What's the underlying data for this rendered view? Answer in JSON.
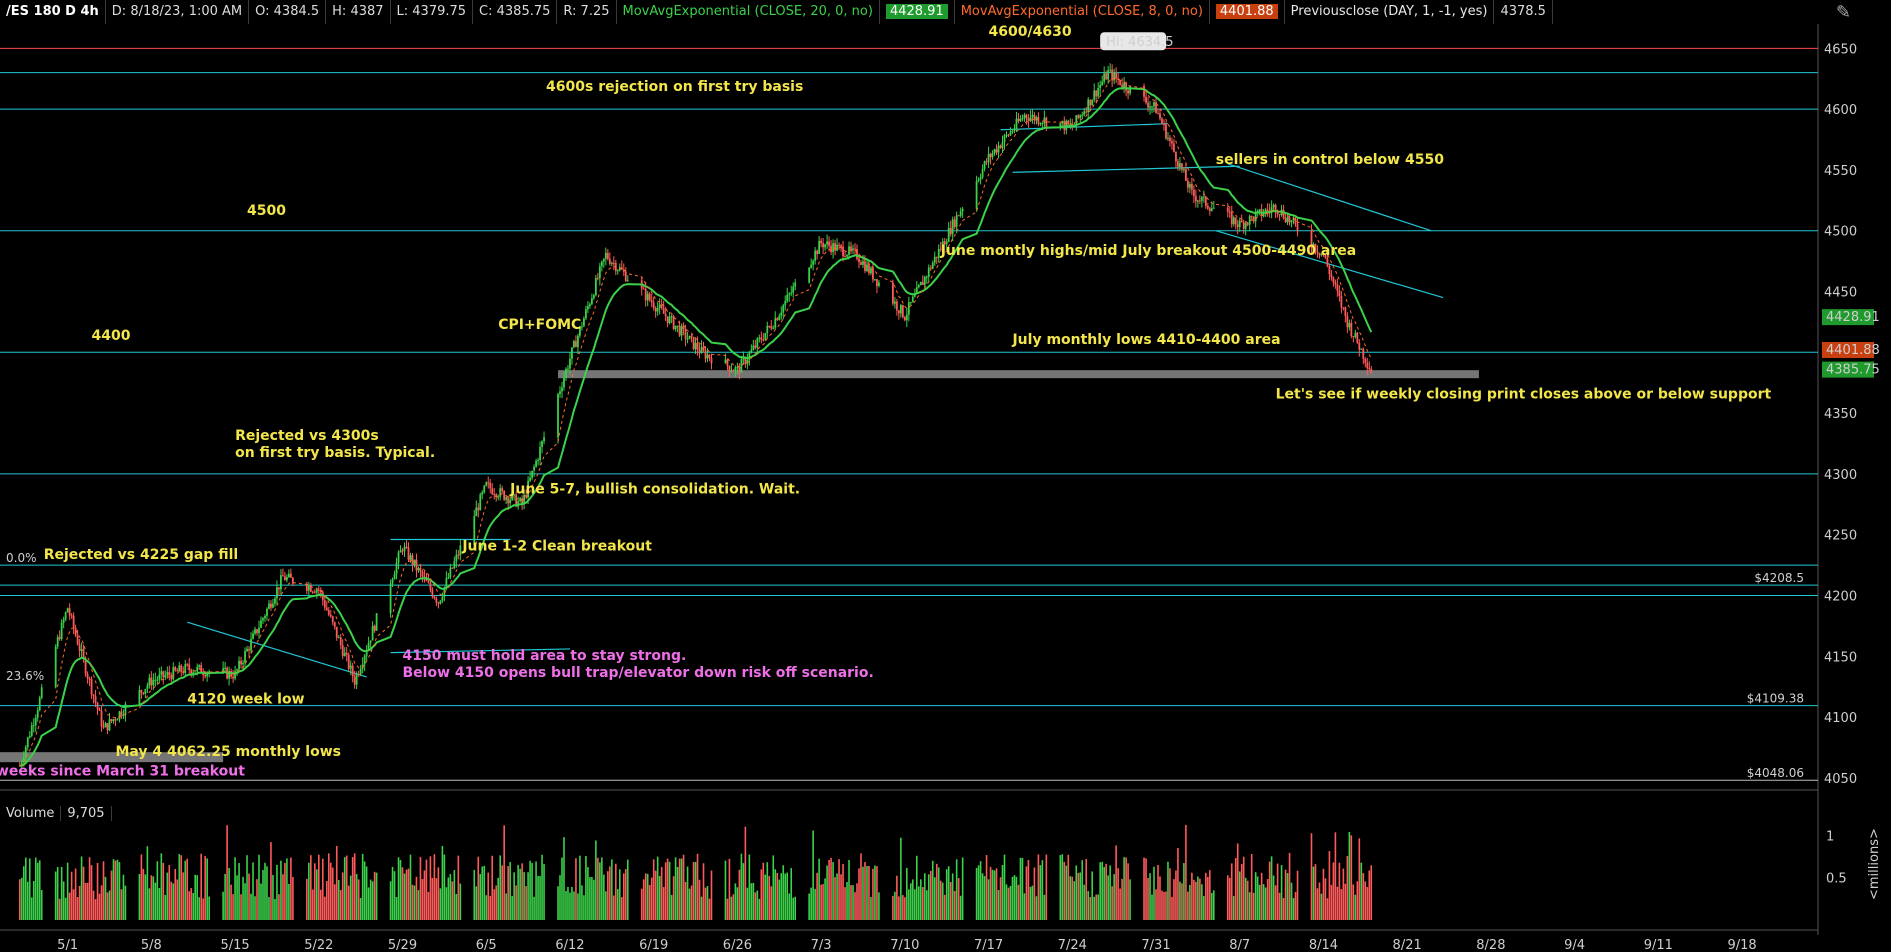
{
  "header": {
    "symbol": "/ES 180 D 4h",
    "date": "D: 8/18/23, 1:00 AM",
    "open": "O: 4384.5",
    "high": "H: 4387",
    "low": "L: 4379.75",
    "close": "C: 4385.75",
    "range": "R: 7.25",
    "ema20_label": "MovAvgExponential (CLOSE, 20, 0, no)",
    "ema20_value": "4428.91",
    "ema8_label": "MovAvgExponential (CLOSE, 8, 0, no)",
    "ema8_value": "4401.88",
    "prevclose_label": "Previousclose (DAY, 1, -1, yes)",
    "prevclose_value": "4378.5"
  },
  "corner_icon": "pencil-icon",
  "volume": {
    "label": "Volume",
    "value": "9,705",
    "unit": "<millions>"
  },
  "colors": {
    "up": "#3bd14a",
    "down": "#ff5a5a",
    "level": "#20c6d4",
    "ema20": "#3bd14a",
    "ema8": "#ff6a2a",
    "annotation": "#f2e64a",
    "annotation_pink": "#ee6fe8"
  },
  "chart_data": {
    "type": "candlestick",
    "y_axis": {
      "range": [
        4040,
        4670
      ],
      "ticks": [
        4050,
        4100,
        4150,
        4200,
        4250,
        4300,
        4350,
        4400,
        4450,
        4500,
        4550,
        4600,
        4650
      ]
    },
    "x_axis": {
      "ticks": [
        "5/1",
        "5/8",
        "5/15",
        "5/22",
        "5/29",
        "6/5",
        "6/12",
        "6/19",
        "6/26",
        "7/3",
        "7/10",
        "7/17",
        "7/24",
        "7/31",
        "8/7",
        "8/14",
        "8/21",
        "8/28",
        "9/4",
        "9/11",
        "9/18"
      ]
    },
    "price_path": [
      [
        "4/27",
        4060
      ],
      [
        "5/1",
        4190
      ],
      [
        "5/4",
        4090
      ],
      [
        "5/8",
        4130
      ],
      [
        "5/11",
        4140
      ],
      [
        "5/15",
        4135
      ],
      [
        "5/19",
        4215
      ],
      [
        "5/22",
        4205
      ],
      [
        "5/25",
        4130
      ],
      [
        "5/29",
        4240
      ],
      [
        "6/1",
        4195
      ],
      [
        "6/5",
        4290
      ],
      [
        "6/8",
        4275
      ],
      [
        "6/12",
        4395
      ],
      [
        "6/15",
        4480
      ],
      [
        "6/19",
        4440
      ],
      [
        "6/23",
        4400
      ],
      [
        "6/26",
        4385
      ],
      [
        "6/29",
        4425
      ],
      [
        "7/3",
        4490
      ],
      [
        "7/6",
        4480
      ],
      [
        "7/10",
        4430
      ],
      [
        "7/14",
        4505
      ],
      [
        "7/17",
        4560
      ],
      [
        "7/20",
        4595
      ],
      [
        "7/24",
        4585
      ],
      [
        "7/27",
        4630
      ],
      [
        "7/31",
        4600
      ],
      [
        "8/3",
        4530
      ],
      [
        "8/7",
        4505
      ],
      [
        "8/10",
        4520
      ],
      [
        "8/14",
        4480
      ],
      [
        "8/16",
        4425
      ],
      [
        "8/18",
        4385
      ]
    ],
    "high_label": "Hi: 4634.5",
    "price_labels": [
      {
        "value": 4428.91,
        "text": "4428.91",
        "color": "#1f9a2c"
      },
      {
        "value": 4401.88,
        "text": "4401.88",
        "color": "#c8400f"
      },
      {
        "value": 4385.75,
        "text": "4385.75",
        "color": "#1f9a2c"
      }
    ],
    "levels": [
      4650,
      4630,
      4600,
      4500,
      4400,
      4300,
      4225,
      4208.5,
      4200,
      4109.38,
      4048.06
    ],
    "level_labels": [
      {
        "value": 4225,
        "text": "0.0%",
        "side": "left"
      },
      {
        "value": 4208.5,
        "text": "$4208.5",
        "side": "right"
      },
      {
        "value": 4128,
        "text": "23.6%",
        "side": "left"
      },
      {
        "value": 4109.38,
        "text": "$4109.38",
        "side": "right"
      },
      {
        "value": 4048.06,
        "text": "$4048.06",
        "side": "right"
      }
    ],
    "support_zone": {
      "from": "6/11",
      "to": "8/27",
      "value": 4382
    },
    "annotations": [
      {
        "text": "4600/4630",
        "at": [
          "7/17",
          4660
        ],
        "color": "yellow"
      },
      {
        "text": "4600s rejection on first try basis",
        "at": [
          "6/10",
          4615
        ],
        "color": "yellow"
      },
      {
        "text": "4500",
        "at": [
          "5/16",
          4513
        ],
        "color": "yellow"
      },
      {
        "text": "4400",
        "at": [
          "5/3",
          4410
        ],
        "color": "yellow"
      },
      {
        "text": "CPI+FOMC",
        "at": [
          "6/6",
          4419
        ],
        "color": "yellow"
      },
      {
        "text": "sellers in control below 4550",
        "at": [
          "8/5",
          4555
        ],
        "color": "yellow"
      },
      {
        "text": "June montly highs/mid July breakout 4500-4490 area",
        "at": [
          "7/13",
          4480
        ],
        "color": "yellow"
      },
      {
        "text": "July monthly lows 4410-4400 area",
        "at": [
          "7/19",
          4407
        ],
        "color": "yellow"
      },
      {
        "text": "Let's see if weekly closing print closes above or below support",
        "at": [
          "8/10",
          4362
        ],
        "color": "yellow"
      },
      {
        "text": "Rejected vs 4300s",
        "at": [
          "5/15",
          4328
        ],
        "color": "yellow"
      },
      {
        "text": "on first try basis. Typical.",
        "at": [
          "5/15",
          4314
        ],
        "color": "yellow"
      },
      {
        "text": "June 5-7, bullish consolidation. Wait.",
        "at": [
          "6/7",
          4284
        ],
        "color": "yellow"
      },
      {
        "text": "June 1-2 Clean breakout",
        "at": [
          "6/3",
          4237
        ],
        "color": "yellow"
      },
      {
        "text": "Rejected vs 4225 gap fill",
        "at": [
          "4/29",
          4230
        ],
        "color": "yellow"
      },
      {
        "text": "4150 must hold area to stay strong.",
        "at": [
          "5/29",
          4147
        ],
        "color": "pink"
      },
      {
        "text": "Below 4150 opens  bull trap/elevator down risk off scenario.",
        "at": [
          "5/29",
          4133
        ],
        "color": "pink"
      },
      {
        "text": "4120  week low",
        "at": [
          "5/11",
          4111
        ],
        "color": "yellow"
      },
      {
        "text": "May 4 4062.25 monthly lows",
        "at": [
          "5/5",
          4068
        ],
        "color": "yellow"
      },
      {
        "text": "weeks since March 31 breakout",
        "at": [
          "4/25",
          4052
        ],
        "color": "pink"
      }
    ],
    "volume": {
      "ticks": [
        {
          "value": 1,
          "text": "1"
        },
        {
          "value": 0.5,
          "text": "0.5"
        }
      ],
      "max": 1.2
    }
  }
}
